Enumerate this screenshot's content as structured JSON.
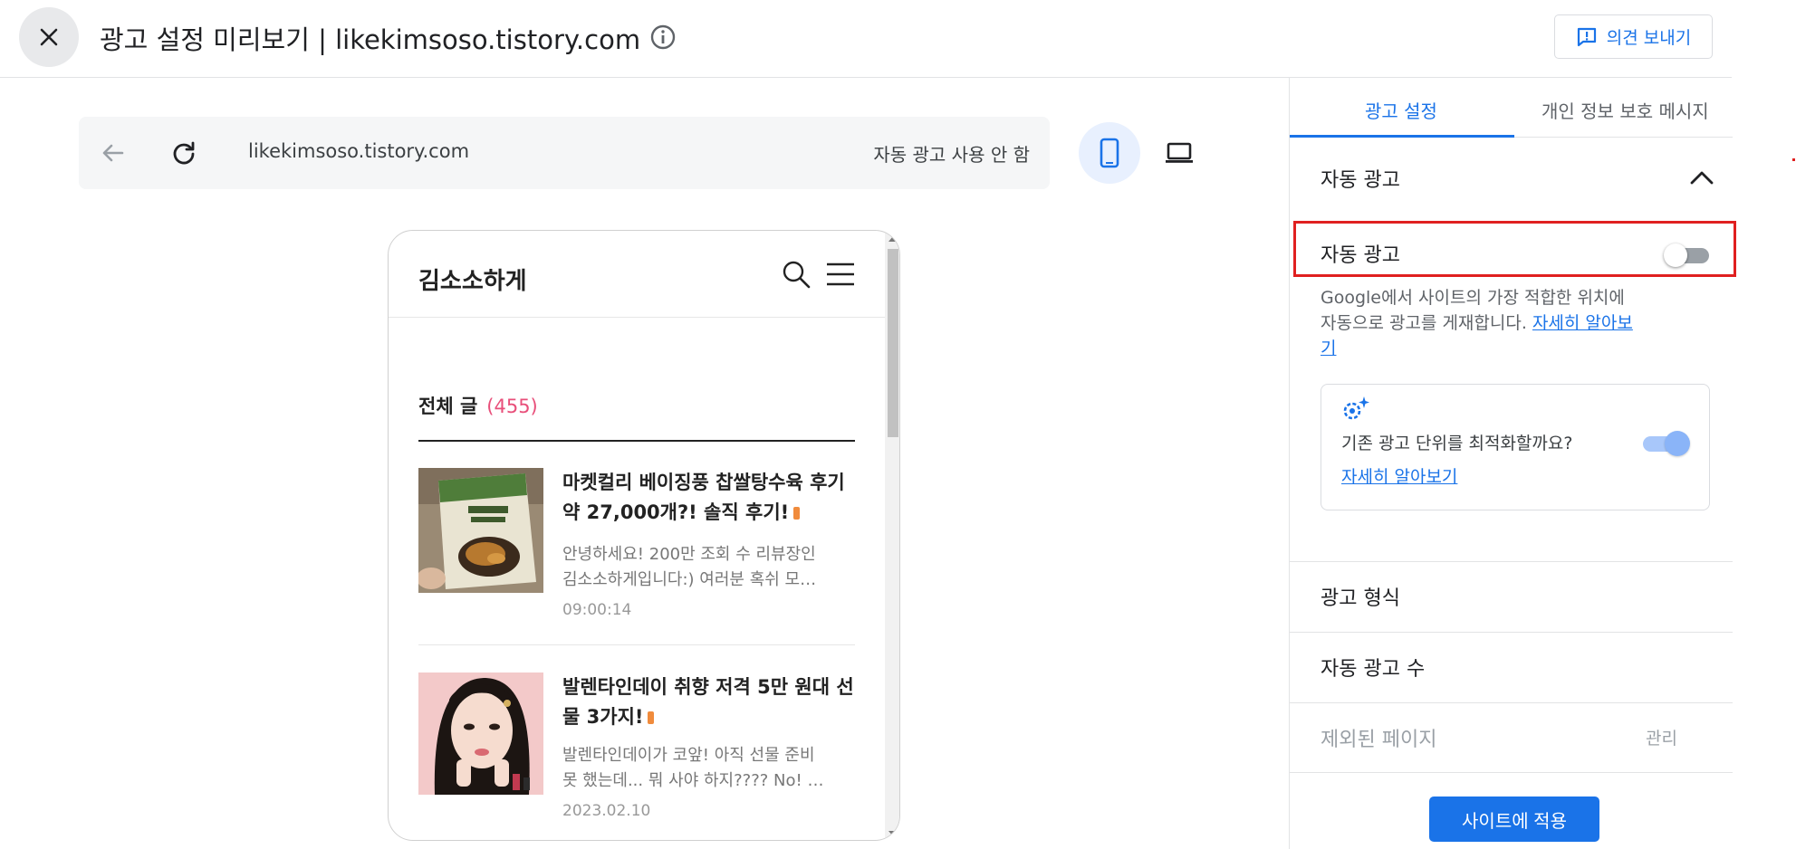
{
  "header": {
    "title": "광고 설정 미리보기 | likekimsoso.tistory.com",
    "feedback_label": "의견 보내기"
  },
  "browser": {
    "url": "likekimsoso.tistory.com",
    "status": "자동 광고 사용 안 함",
    "active_device": "mobile"
  },
  "blog": {
    "title": "김소소하게",
    "all_posts_label": "전체 글",
    "all_posts_count": "(455)",
    "posts": [
      {
        "title": "마켓컬리 베이징풍 찹쌀탕수육 후기 약 27,000개?! 솔직 후기!",
        "excerpt_line1": "안녕하세요! 200만 조회 수 리뷰장인",
        "excerpt_line2": "김소소하게입니다:) 여러분 혹쉬 모…",
        "date": "09:00:14"
      },
      {
        "title": "발렌타인데이 취향 저격 5만 원대 선물 3가지!",
        "excerpt_line1": "발렌타인데이가 코앞! 아직 선물 준비",
        "excerpt_line2": "못 했는데... 뭐 사야 하지???? No! …",
        "date": "2023.02.10"
      }
    ]
  },
  "panel": {
    "tabs": [
      "광고 설정",
      "개인 정보 보호 메시지"
    ],
    "auto_ads_section": "자동 광고",
    "auto_ads_toggle_label": "자동 광고",
    "auto_ads_enabled": false,
    "description": "Google에서 사이트의 가장 적합한 위치에 자동으로 광고를 게재합니다.",
    "learn_more": "자세히 알아보기",
    "optimize_question": "기존 광고 단위를 최적화할까요?",
    "optimize_enabled": true,
    "optimize_learn_more": "자세히 알아보기",
    "ad_formats": "광고 형식",
    "ad_load": "자동 광고 수",
    "excluded_pages": "제외된 페이지",
    "manage": "관리",
    "apply_button": "사이트에 적용"
  },
  "colors": {
    "accent": "#1a73e8",
    "highlight": "#e02020",
    "count_pink": "#e84f7a"
  }
}
